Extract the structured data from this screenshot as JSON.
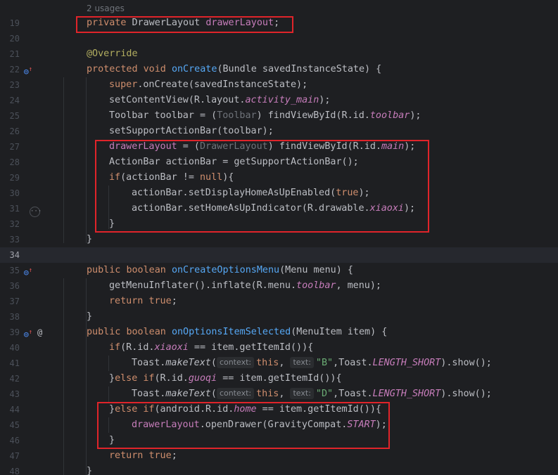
{
  "usages_label": "2 usages",
  "lines": [
    {
      "n": "19"
    },
    {
      "n": "20"
    },
    {
      "n": "21"
    },
    {
      "n": "22"
    },
    {
      "n": "23"
    },
    {
      "n": "24"
    },
    {
      "n": "25"
    },
    {
      "n": "26"
    },
    {
      "n": "27"
    },
    {
      "n": "28"
    },
    {
      "n": "29"
    },
    {
      "n": "30"
    },
    {
      "n": "31"
    },
    {
      "n": "32"
    },
    {
      "n": "33"
    },
    {
      "n": "34"
    },
    {
      "n": "35"
    },
    {
      "n": "36"
    },
    {
      "n": "37"
    },
    {
      "n": "38"
    },
    {
      "n": "39"
    },
    {
      "n": "40"
    },
    {
      "n": "41"
    },
    {
      "n": "42"
    },
    {
      "n": "43"
    },
    {
      "n": "44"
    },
    {
      "n": "45"
    },
    {
      "n": "46"
    },
    {
      "n": "47"
    },
    {
      "n": "48"
    }
  ],
  "code": {
    "l19": {
      "kw": "private",
      "type": "DrawerLayout",
      "field": "drawerLayout",
      "end": ";"
    },
    "l21": {
      "ann": "@Override"
    },
    "l22": {
      "kw": "protected",
      "kw2": "void",
      "fn": "onCreate",
      "rest": "(Bundle savedInstanceState) {"
    },
    "l23": {
      "kw": "super",
      "rest": ".onCreate(savedInstanceState);"
    },
    "l24": {
      "a": "setContentView(R.layout.",
      "field": "activity_main",
      "b": ");"
    },
    "l25": {
      "a": "Toolbar toolbar = (",
      "cast": "Toolbar",
      "b": ") findViewById(R.id.",
      "field": "toolbar",
      "c": ");"
    },
    "l26": {
      "a": "setSupportActionBar(toolbar);"
    },
    "l27": {
      "field": "drawerLayout",
      "a": " = (",
      "cast": "DrawerLayout",
      "b": ") findViewById(R.id.",
      "field2": "main",
      "c": ");"
    },
    "l28": {
      "a": "ActionBar actionBar = getSupportActionBar();"
    },
    "l29": {
      "kw": "if",
      "a": "(actionBar != ",
      "kw2": "null",
      "b": "){"
    },
    "l30": {
      "a": "actionBar.setDisplayHomeAsUpEnabled(",
      "kw": "true",
      "b": ");"
    },
    "l31": {
      "a": "actionBar.setHomeAsUpIndicator(R.drawable.",
      "field": "xiaoxi",
      "b": ");"
    },
    "l32": {
      "a": "}"
    },
    "l33": {
      "a": "}"
    },
    "l35": {
      "kw": "public",
      "kw2": "boolean",
      "fn": "onCreateOptionsMenu",
      "rest": "(Menu menu) {"
    },
    "l36": {
      "a": "getMenuInflater().inflate(R.menu.",
      "field": "toolbar",
      "b": ", menu);"
    },
    "l37": {
      "kw": "return",
      "kw2": "true",
      "b": ";"
    },
    "l38": {
      "a": "}"
    },
    "l39": {
      "kw": "public",
      "kw2": "boolean",
      "fn": "onOptionsItemSelected",
      "rest": "(MenuItem item) {"
    },
    "l40": {
      "kw": "if",
      "a": "(R.id.",
      "field": "xiaoxi",
      "b": " == item.getItemId()){"
    },
    "l41": {
      "a": "Toast.",
      "sm": "makeText",
      "b": "(",
      "h1": "context:",
      "kw": "this",
      "c": ",",
      "h2": "text:",
      "str": "\"B\"",
      "d": ",Toast.",
      "sf": "LENGTH_SHORT",
      "e": ").show();"
    },
    "l42": {
      "a": "}",
      "kw": "else if",
      "b": "(R.id.",
      "field": "guoqi",
      "c": " == item.getItemId()){"
    },
    "l43": {
      "a": "Toast.",
      "sm": "makeText",
      "b": "(",
      "h1": "context:",
      "kw": "this",
      "c": ",",
      "h2": "text:",
      "str": "\"D\"",
      "d": ",Toast.",
      "sf": "LENGTH_SHORT",
      "e": ").show();"
    },
    "l44": {
      "a": "}",
      "kw": "else if",
      "b": "(android.R.id.",
      "field": "home",
      "c": " == item.getItemId()){"
    },
    "l45": {
      "field": "drawerLayout",
      "a": ".openDrawer(GravityCompat.",
      "sf": "START",
      "b": ");"
    },
    "l46": {
      "a": "}"
    },
    "l47": {
      "kw": "return",
      "kw2": "true",
      "b": ";"
    },
    "l48": {
      "a": "}"
    }
  },
  "colors": {
    "background": "#1e1f22",
    "keyword": "#cf8e6d",
    "function": "#56a8f5",
    "field": "#c77dbb",
    "string": "#6aab73",
    "annotation": "#b3ae60",
    "highlight_box": "#e0242a"
  },
  "gutter_icons": {
    "l22": "override-icon",
    "l31": "more-dots-icon",
    "l35": "override-icon",
    "l39": "override-icon",
    "l39b": "at-annotation-icon"
  }
}
